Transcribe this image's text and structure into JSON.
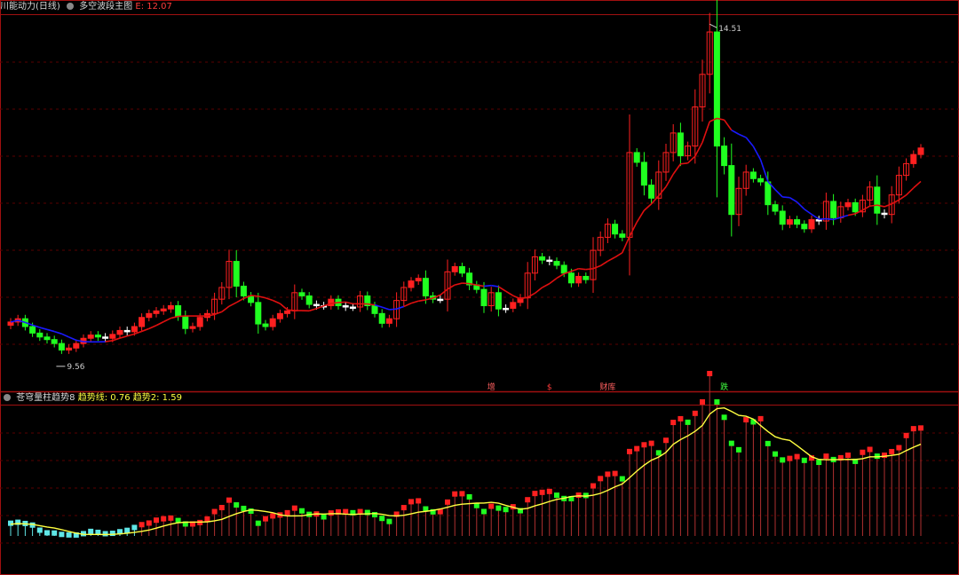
{
  "top_title": {
    "formula": "川能动力(日线)",
    "indicator": "多空波段主图",
    "e_label": "E: 12.07"
  },
  "bottom_title": {
    "indicator": "苍穹量柱趋势8",
    "trend1": "趋势线: 0.76",
    "trend2": "趋势2: 1.59"
  },
  "signals": [
    {
      "text": "增",
      "i": 66,
      "color": "#ff6060"
    },
    {
      "text": "$",
      "i": 74,
      "color": "#ff3b3b"
    },
    {
      "text": "财库",
      "i": 82,
      "color": "#ff6060"
    },
    {
      "text": "跌",
      "i": 98,
      "color": "#40ff40"
    }
  ],
  "colors": {
    "up": "#ff2020",
    "down": "#20ff20",
    "neutral": "#ffffff",
    "ma_up": "#e01010",
    "ma_down": "#1a1aff",
    "yellow": "#ffff40",
    "cyan": "#5fe6e6",
    "grid": "#5a0000",
    "border": "#a01010"
  },
  "chart_data": [
    {
      "type": "candlestick",
      "title": "多空波段主图",
      "price_range": [
        9.0,
        14.8
      ],
      "high_label": "14.51",
      "low_label": "9.56",
      "close": [
        10.05,
        10.1,
        9.98,
        9.88,
        9.82,
        9.78,
        9.72,
        9.62,
        9.65,
        9.72,
        9.8,
        9.85,
        9.82,
        9.8,
        9.86,
        9.92,
        9.9,
        9.98,
        10.12,
        10.18,
        10.22,
        10.25,
        10.3,
        10.14,
        9.95,
        9.98,
        10.12,
        10.18,
        10.4,
        10.58,
        10.98,
        10.6,
        10.45,
        10.35,
        10.02,
        9.98,
        10.1,
        10.18,
        10.22,
        10.5,
        10.45,
        10.32,
        10.3,
        10.3,
        10.4,
        10.3,
        10.28,
        10.28,
        10.45,
        10.3,
        10.18,
        10.03,
        10.1,
        10.38,
        10.58,
        10.68,
        10.72,
        10.45,
        10.4,
        10.4,
        10.82,
        10.9,
        10.8,
        10.62,
        10.55,
        10.3,
        10.5,
        10.25,
        10.26,
        10.35,
        10.42,
        10.8,
        11.05,
        11.0,
        10.98,
        10.92,
        10.8,
        10.65,
        10.75,
        10.7,
        11.15,
        11.35,
        11.55,
        11.4,
        11.35,
        12.65,
        12.5,
        12.15,
        11.95,
        12.35,
        12.65,
        12.95,
        12.6,
        12.75,
        13.35,
        13.85,
        14.5,
        12.75,
        12.45,
        11.7,
        12.1,
        12.35,
        12.25,
        12.2,
        11.85,
        11.75,
        11.55,
        11.62,
        11.55,
        11.48,
        11.62,
        11.6,
        11.9,
        11.65,
        11.82,
        11.88,
        11.74,
        11.92,
        12.12,
        11.72,
        11.7,
        12.0,
        12.3,
        12.48,
        12.62,
        12.72
      ],
      "ma_up": [
        false,
        false,
        false,
        false,
        false,
        false,
        false,
        false,
        false,
        false,
        false,
        false,
        false,
        false,
        true,
        true,
        true,
        true,
        true,
        true,
        true,
        true,
        true,
        true,
        true,
        true,
        true,
        true,
        true,
        true,
        true,
        true,
        true,
        true,
        true,
        true,
        true,
        true,
        true,
        true,
        true,
        true,
        true,
        true,
        true,
        true,
        true,
        true,
        true,
        true,
        true,
        false,
        false,
        false,
        false,
        true,
        true,
        true,
        true,
        true,
        true,
        true,
        true,
        true,
        true,
        true,
        false,
        false,
        true,
        true,
        true,
        true,
        true,
        true,
        true,
        true,
        true,
        true,
        true,
        true,
        true,
        true,
        true,
        true,
        true,
        true,
        true,
        true,
        true,
        true,
        true,
        true,
        true,
        true,
        true,
        true,
        true,
        true,
        true,
        true,
        false,
        false,
        false,
        false,
        false,
        false,
        false,
        false,
        false,
        false,
        false,
        false,
        false,
        false,
        false,
        false,
        true,
        true,
        true,
        true,
        true,
        true,
        true,
        true,
        true,
        true,
        true,
        true
      ]
    },
    {
      "type": "bar",
      "title": "苍穹量柱趋势8",
      "series": [
        {
          "name": "趋势线",
          "value": 0.76
        },
        {
          "name": "趋势2",
          "value": 1.59
        }
      ]
    }
  ]
}
